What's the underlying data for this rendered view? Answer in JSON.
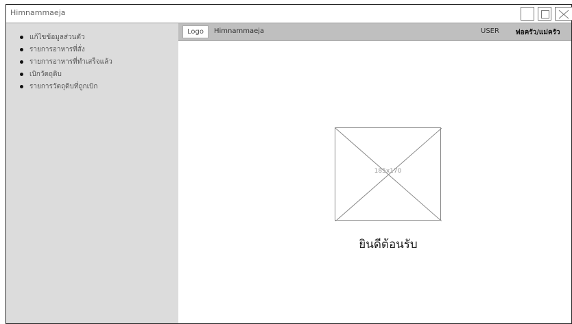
{
  "window": {
    "title": "Himnammaeja"
  },
  "sidebar": {
    "items": [
      {
        "label": "แก้ไขข้อมูลส่วนตัว"
      },
      {
        "label": "รายการอาหารที่สั่ง"
      },
      {
        "label": "รายการอาหารที่ทำเสร็จแล้ว"
      },
      {
        "label": "เบิกวัตถุดิบ"
      },
      {
        "label": "รายการวัตถุดิบที่ถูกเบิก"
      }
    ]
  },
  "header": {
    "logo": "Logo",
    "app_name": "Himnammaeja",
    "user_label": "USER",
    "user_value": "พ่อครัว/แม่ครัว"
  },
  "main": {
    "image_placeholder": "185x170",
    "welcome": "ยินดีต้อนรับ"
  }
}
